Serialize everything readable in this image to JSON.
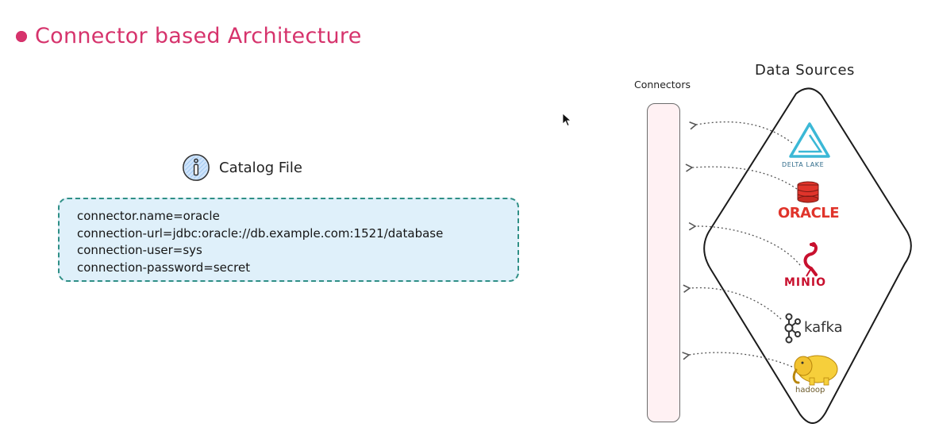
{
  "title": {
    "text": "Connector based Architecture",
    "color": "#d6336c"
  },
  "catalog": {
    "icon": "info-icon",
    "title": "Catalog File",
    "lines": [
      "connector.name=oracle",
      "connection-url=jdbc:oracle://db.example.com:1521/database",
      "connection-user=sys",
      "connection-password=secret"
    ],
    "box_color": "#dff0fa",
    "border_color": "#2f8f86"
  },
  "diagram": {
    "connectors_label": "Connectors",
    "data_sources_label": "Data Sources",
    "sources": [
      {
        "name": "DELTA LAKE",
        "icon": "delta-lake-icon",
        "color": "#3bb8d6"
      },
      {
        "name": "ORACLE",
        "icon": "database-icon",
        "color": "#e0342b"
      },
      {
        "name": "MINIO",
        "icon": "flamingo-icon",
        "color": "#c8102e"
      },
      {
        "name": "kafka",
        "icon": "kafka-icon",
        "color": "#333333"
      },
      {
        "name": "hadoop",
        "icon": "elephant-icon",
        "color": "#f2c230"
      }
    ]
  }
}
